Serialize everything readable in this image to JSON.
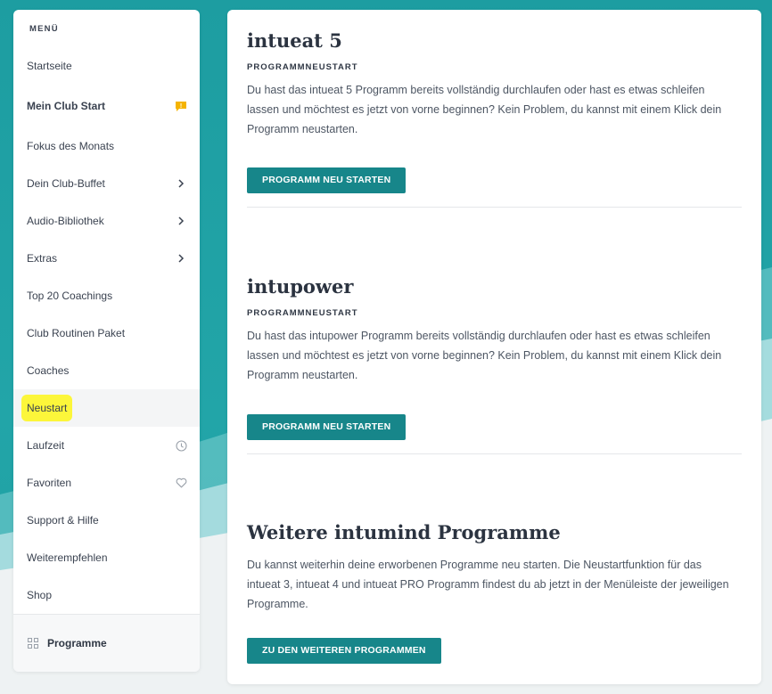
{
  "sidebar": {
    "heading": "MENÜ",
    "items": [
      {
        "label": "Startseite"
      },
      {
        "label": "Mein Club Start",
        "badge": "!"
      },
      {
        "label": "Fokus des Monats"
      },
      {
        "label": "Dein Club-Buffet",
        "icon": "chevron-right-icon"
      },
      {
        "label": "Audio-Bibliothek",
        "icon": "chevron-right-icon"
      },
      {
        "label": "Extras",
        "icon": "chevron-right-icon"
      },
      {
        "label": "Top 20 Coachings"
      },
      {
        "label": "Club Routinen Paket"
      },
      {
        "label": "Coaches"
      },
      {
        "label": "Neustart",
        "active": true
      },
      {
        "label": "Laufzeit",
        "icon": "clock-icon"
      },
      {
        "label": "Favoriten",
        "icon": "heart-icon"
      },
      {
        "label": "Support & Hilfe"
      },
      {
        "label": "Weiterempfehlen"
      },
      {
        "label": "Shop"
      }
    ],
    "footer_label": "Programme"
  },
  "sections": [
    {
      "title": "intueat 5",
      "subtitle": "PROGRAMMNEUSTART",
      "text": "Du hast das intueat 5 Programm bereits vollständig durchlaufen oder hast es etwas schleifen lassen und möchtest es jetzt von vorne beginnen? Kein Problem, du kannst mit einem Klick dein Programm neustarten.",
      "button": "PROGRAMM NEU STARTEN"
    },
    {
      "title": "intupower",
      "subtitle": "PROGRAMMNEUSTART",
      "text": "Du hast das intupower Programm bereits vollständig durchlaufen oder hast es etwas schleifen lassen und möchtest es jetzt von vorne beginnen? Kein Problem, du kannst mit einem Klick dein Programm neustarten.",
      "button": "PROGRAMM NEU STARTEN"
    },
    {
      "title": "Weitere intumind Programme",
      "text": "Du kannst weiterhin deine erworbenen Programme neu starten. Die Neustartfunktion für das intueat 3, intueat 4 und intueat PRO Programm findest du ab jetzt in der Menüleiste der jeweiligen Programme.",
      "button": "ZU DEN WEITEREN PROGRAMMEN"
    }
  ],
  "colors": {
    "teal_background": "#1d9da1",
    "button": "#17868a",
    "highlight": "#fcf63a",
    "badge": "#f5b400"
  }
}
